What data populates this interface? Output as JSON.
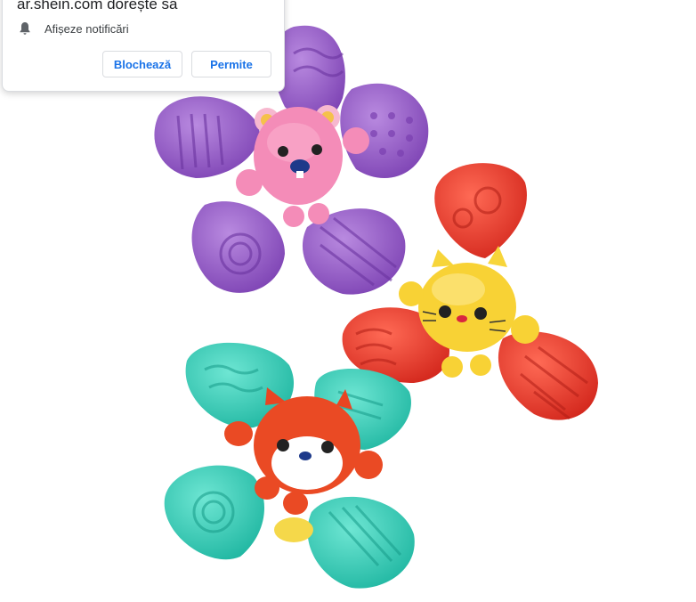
{
  "notification_prompt": {
    "origin_text": "ar.shein.com dorește să",
    "permission_icon": "bell-icon",
    "permission_label": "Afișeze notificări",
    "block_label": "Blochează",
    "allow_label": "Permite",
    "accent_color": "#1a73e8"
  },
  "product_image": {
    "toys": [
      {
        "animal": "pink-beaver",
        "spinner_color": "#9b59c9"
      },
      {
        "animal": "yellow-cat",
        "spinner_color": "#e8402e"
      },
      {
        "animal": "orange-fox",
        "spinner_color": "#3ecfb8"
      }
    ]
  }
}
